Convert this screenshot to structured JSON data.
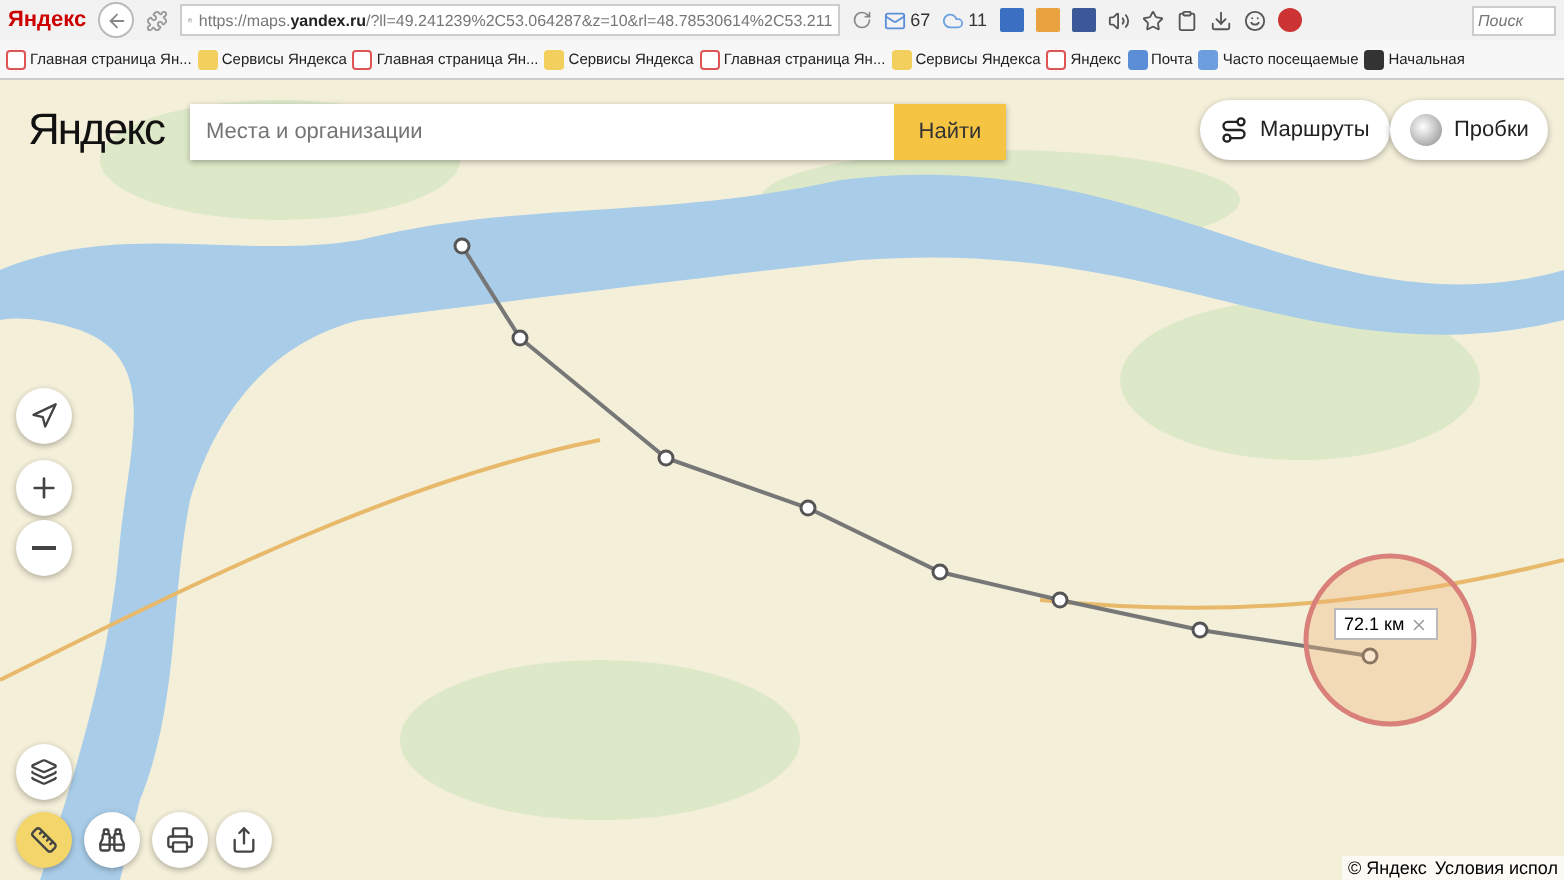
{
  "browser": {
    "logo": "Яндекс",
    "url_prefix": "https://maps.",
    "url_domain": "yandex.ru",
    "url_rest": "/?ll=49.241239%2C53.064287&z=10&rl=48.78530614%2C53.211",
    "mail_count": "67",
    "weather": "11",
    "search_placeholder": "Поиск"
  },
  "bookmarks": [
    {
      "label": "Главная страница Ян...",
      "kind": "yandex"
    },
    {
      "label": "Сервисы Яндекса",
      "kind": "folder"
    },
    {
      "label": "Главная страница Ян...",
      "kind": "yandex"
    },
    {
      "label": "Сервисы Яндекса",
      "kind": "folder"
    },
    {
      "label": "Главная страница Ян...",
      "kind": "yandex"
    },
    {
      "label": "Сервисы Яндекса",
      "kind": "folder"
    },
    {
      "label": "Яндекс",
      "kind": "yandex"
    },
    {
      "label": "Почта",
      "kind": "mail"
    },
    {
      "label": "Часто посещаемые",
      "kind": "page"
    },
    {
      "label": "Начальная",
      "kind": "m"
    }
  ],
  "map": {
    "logo": "Яндекс",
    "search": {
      "placeholder": "Места и организации",
      "button": "Найти"
    },
    "routes_button": "Маршруты",
    "traffic_button": "Пробки",
    "ruler": {
      "active": true
    },
    "distance": "72.1 км",
    "copyright": "© Яндекс",
    "terms": "Условия испол"
  }
}
